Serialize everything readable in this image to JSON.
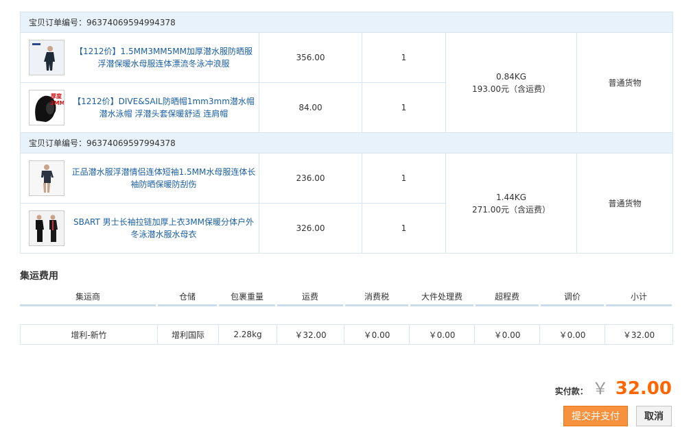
{
  "groups": [
    {
      "order_label": "宝贝订单编号：",
      "order_no": "96374069594994378",
      "weight": "0.84KG",
      "amount": "193.00元（含运费）",
      "cargo_type": "普通货物",
      "items": [
        {
          "name": "【1212价】1.5MM3MM5MM加厚潜水服防晒服浮潜保暖水母服连体漂流冬泳冲浪服",
          "price": "356.00",
          "qty": "1",
          "icon": "wetsuit-thumbnail-icon"
        },
        {
          "name": "【1212价】DIVE&SAIL防晒帽1mm3mm潜水帽 潜水泳帽 浮潜头套保暖舒适 连肩帽",
          "price": "84.00",
          "qty": "1",
          "icon": "diving-hood-thumbnail-icon",
          "thumb_text": "厚度3MM"
        }
      ]
    },
    {
      "order_label": "宝贝订单编号：",
      "order_no": "96374069597994378",
      "weight": "1.44KG",
      "amount": "271.00元（含运费）",
      "cargo_type": "普通货物",
      "items": [
        {
          "name": "正品潜水服浮潜情侣连体短袖1.5MM水母服连体长袖防晒保暖防刮伤",
          "price": "236.00",
          "qty": "1",
          "icon": "shorty-wetsuit-thumbnail-icon"
        },
        {
          "name": "SBART 男士长袖拉链加厚上衣3MM保暖分体户外冬泳潜水服水母衣",
          "price": "326.00",
          "qty": "1",
          "icon": "wetsuit-top-thumbnail-icon"
        }
      ]
    }
  ],
  "shipping": {
    "title": "集运费用",
    "headers": [
      "集运商",
      "仓储",
      "包裹重量",
      "运费",
      "消费税",
      "大件处理费",
      "超程费",
      "调价",
      "小计"
    ],
    "row": [
      "增利-新竹",
      "增利国际",
      "2.28kg",
      "￥32.00",
      "￥0.00",
      "￥0.00",
      "￥0.00",
      "￥0.00",
      "￥32.00"
    ]
  },
  "total": {
    "label": "实付款：",
    "currency": "￥",
    "amount": "32.00"
  },
  "buttons": {
    "pay": "提交并支付",
    "cancel": "取消"
  },
  "colors": {
    "accent": "#ff6600",
    "pay_button": "#f7913d",
    "link": "#1a5fa3",
    "header_bg": "#e8f2fb"
  }
}
